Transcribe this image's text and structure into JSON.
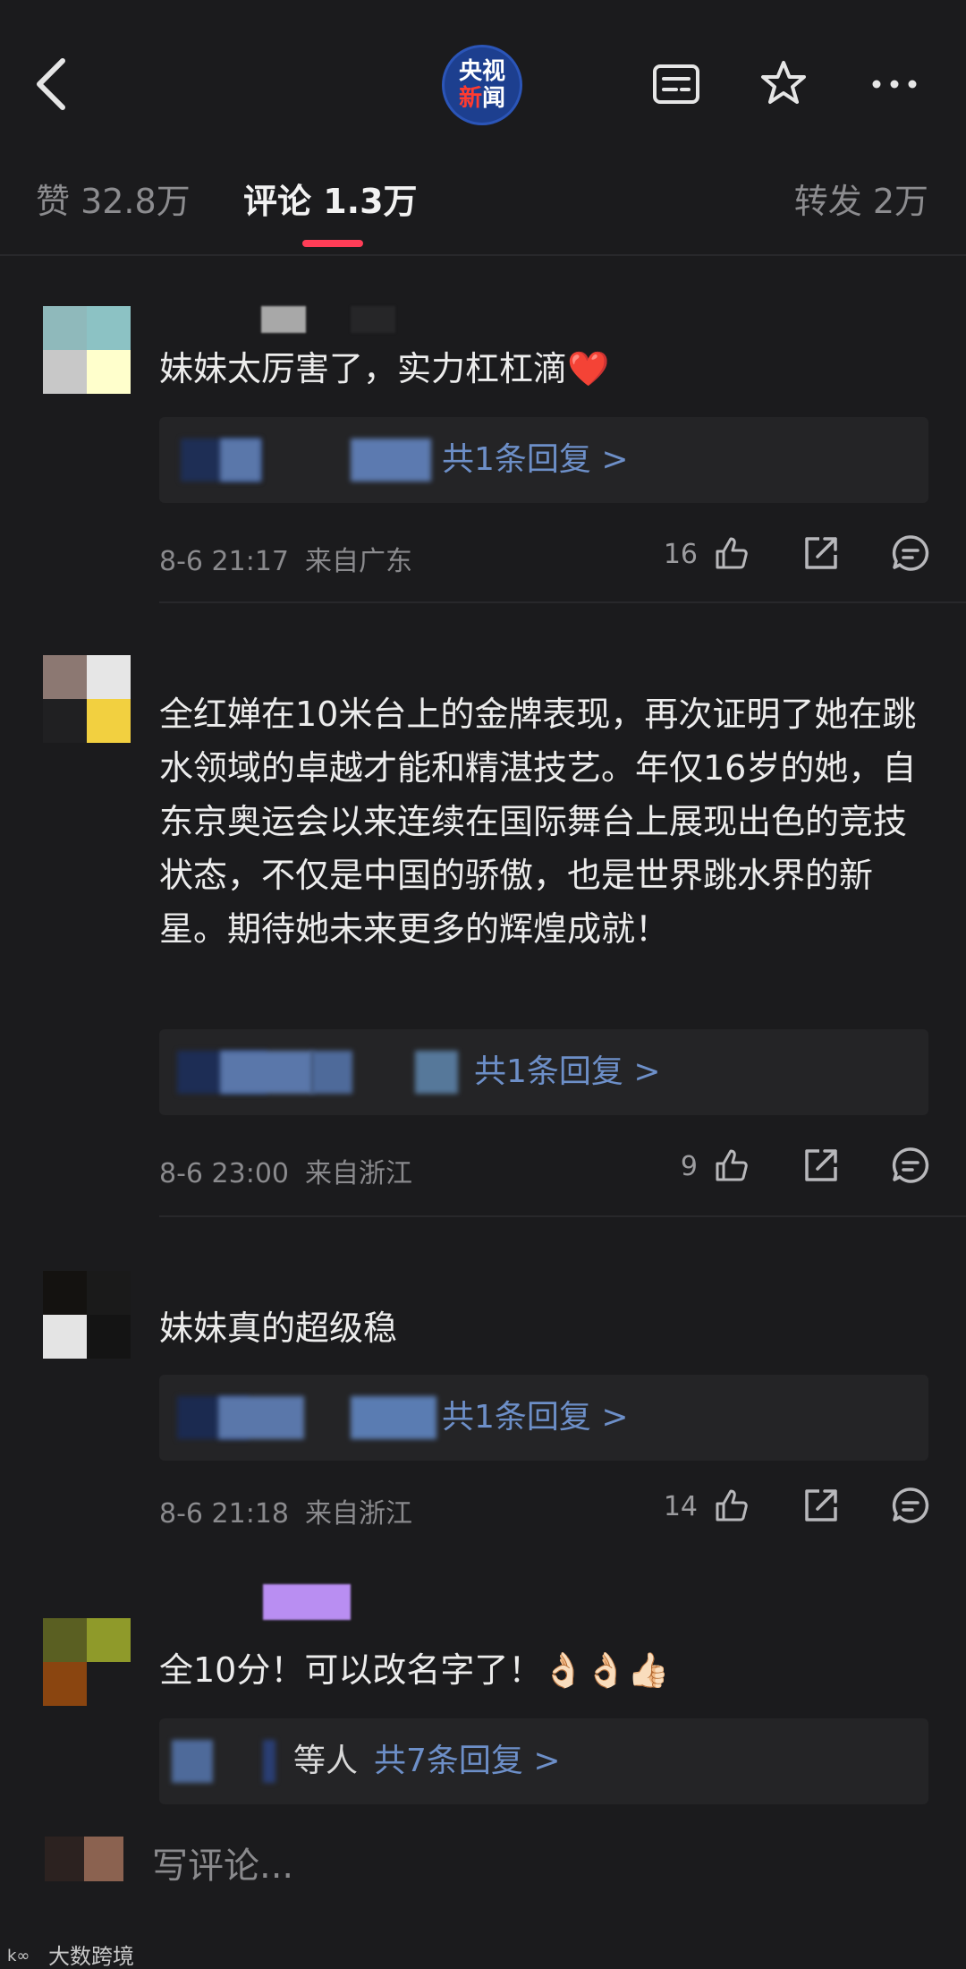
{
  "header": {
    "logo_line1": "央视",
    "logo_line2_a": "新",
    "logo_line2_b": "闻"
  },
  "tabs": {
    "likes": "赞 32.8万",
    "comments": "评论 1.3万",
    "reposts": "转发 2万"
  },
  "comments": [
    {
      "text": "妹妹太厉害了，实力杠杠滴❤️",
      "reply_link": "共1条回复 >",
      "time": "8-6 21:17",
      "location": "来自广东",
      "likes": "16"
    },
    {
      "text": "全红婵在10米台上的金牌表现，再次证明了她在跳水领域的卓越才能和精湛技艺。年仅16岁的她，自东京奥运会以来连续在国际舞台上展现出色的竞技状态，不仅是中国的骄傲，也是世界跳水界的新星。期待她未来更多的辉煌成就！",
      "reply_link": "共1条回复 >",
      "time": "8-6 23:00",
      "location": "来自浙江",
      "likes": "9"
    },
    {
      "text": "妹妹真的超级稳",
      "reply_link": "共1条回复 >",
      "time": "8-6 21:18",
      "location": "来自浙江",
      "likes": "14"
    },
    {
      "text": "全10分！可以改名字了！👌🏻👌🏻👍🏻",
      "reply_extra": "等人",
      "reply_link": "共7条回复 >"
    }
  ],
  "compose": {
    "placeholder": "写评论..."
  },
  "watermark": {
    "text": "大数跨境"
  },
  "colors": {
    "accent": "#ff3d57",
    "link": "#6d8fc8",
    "background": "#1b1b1d"
  },
  "icons": [
    "back-icon",
    "article-icon",
    "star-icon",
    "more-icon",
    "thumbs-up-icon",
    "share-icon",
    "comment-icon"
  ]
}
